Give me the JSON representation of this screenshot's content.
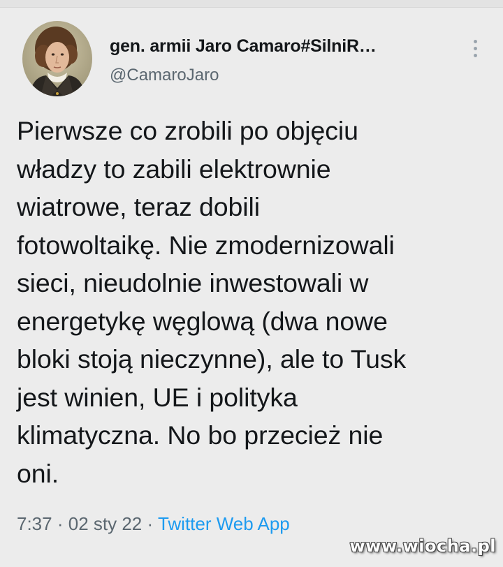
{
  "tweet": {
    "author": {
      "display_name": "gen. armii Jaro Camaro#SilniR…",
      "handle": "@CamaroJaro",
      "avatar_icon": "portrait-avatar-icon"
    },
    "text": "Pierwsze co zrobili po objęciu\nwładzy to zabili elektrownie\nwiatrowe, teraz dobili\nfotowoltaikę. Nie zmodernizowali\nsieci, nieudolnie inwestowali w\nenergetykę węglową (dwa nowe\nbloki stoją nieczynne), ale to Tusk\njest winien, UE i polityka\nklimatyczna. No bo przecież nie\noni.",
    "time": "7:37",
    "separator": "·",
    "date": "02 sty 22",
    "source": "Twitter Web App"
  },
  "watermark": "www.wiocha.pl",
  "colors": {
    "background": "#ececec",
    "text": "#14171a",
    "secondary_text": "#5b6770",
    "link": "#1d9bf0"
  }
}
